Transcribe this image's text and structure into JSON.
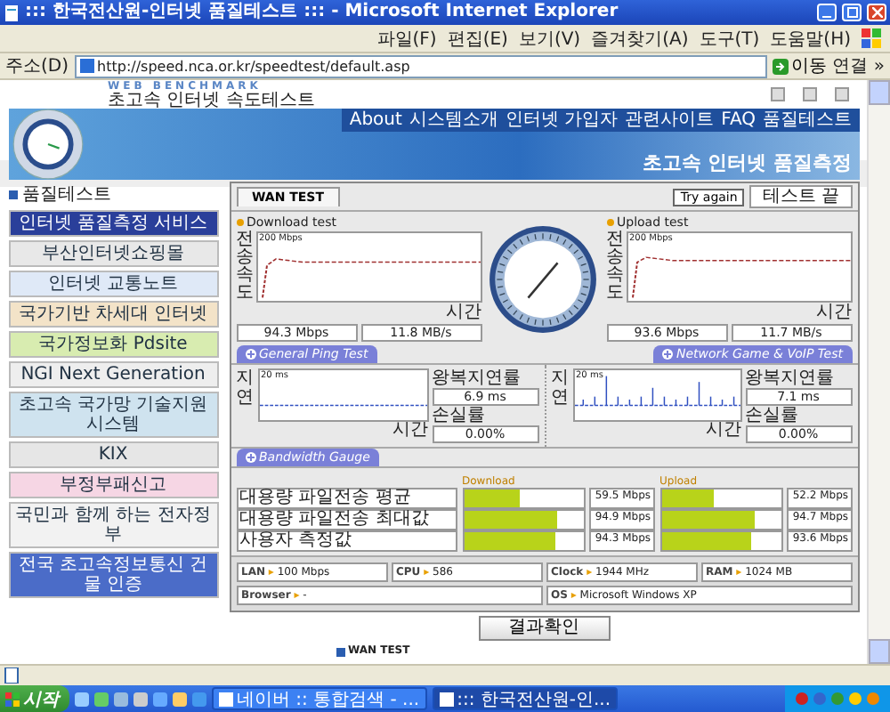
{
  "window": {
    "title": "::: 한국전산원-인터넷 품질테스트 ::: - Microsoft Internet Explorer"
  },
  "menu": [
    "파일(F)",
    "편집(E)",
    "보기(V)",
    "즐겨찾기(A)",
    "도구(T)",
    "도움말(H)"
  ],
  "address": {
    "label": "주소(D)",
    "value": "http://speed.nca.or.kr/speedtest/default.asp",
    "go": "이동",
    "links": "연결 »"
  },
  "header": {
    "tagline": "WEB BENCHMARK",
    "title": "초고속 인터넷 속도테스트"
  },
  "nav": [
    "About",
    "시스템소개",
    "인터넷 가입자",
    "관련사이트",
    "FAQ",
    "품질테스트"
  ],
  "banner": {
    "title": "초고속 인터넷 품질측정"
  },
  "sidebar": {
    "heading": "품질테스트",
    "banners": [
      "인터넷 품질측정 서비스",
      "부산인터넷쇼핑몰",
      "인터넷 교통노트",
      "국가기반 차세대 인터넷",
      "국가정보화 Pdsite",
      "NGI Next Generation",
      "초고속 국가망 기술지원 시스템",
      "KIX",
      "부정부패신고",
      "국민과 함께 하는 전자정부",
      "전국 초고속정보통신 건물 인증"
    ]
  },
  "test": {
    "tab": "WAN TEST",
    "try_again": "Try again",
    "status": "테스트 끝",
    "download": {
      "title": "Download test",
      "axis": "전송속도",
      "max": "200 Mbps",
      "time": "시간",
      "speed": "94.3 Mbps",
      "rate": "11.8 MB/s"
    },
    "upload": {
      "title": "Upload test",
      "axis": "전송속도",
      "max": "200 Mbps",
      "time": "시간",
      "speed": "93.6 Mbps",
      "rate": "11.7 MB/s"
    },
    "ping_tabs": [
      "General Ping Test",
      "Network Game & VoIP Test"
    ],
    "ping": [
      {
        "axis": "지연",
        "max": "20 ms",
        "delay_label": "왕복지연률",
        "delay": "6.9 ms",
        "loss_label": "손실률",
        "loss": "0.00%",
        "time": "시간"
      },
      {
        "axis": "지연",
        "max": "20 ms",
        "delay_label": "왕복지연률",
        "delay": "7.1 ms",
        "loss_label": "손실률",
        "loss": "0.00%",
        "time": "시간"
      }
    ],
    "gauge_tab": "Bandwidth Gauge",
    "gauge_columns": [
      "Download",
      "Upload"
    ],
    "gauge_rows": [
      {
        "label": "대용량 파일전송 평균",
        "download": {
          "level": 0.47,
          "value": "59.5 Mbps"
        },
        "upload": {
          "level": 0.44,
          "value": "52.2 Mbps"
        }
      },
      {
        "label": "대용량 파일전송 최대값",
        "download": {
          "level": 0.78,
          "value": "94.9 Mbps"
        },
        "upload": {
          "level": 0.78,
          "value": "94.7 Mbps"
        }
      },
      {
        "label": "사용자 측정값",
        "download": {
          "level": 0.77,
          "value": "94.3 Mbps"
        },
        "upload": {
          "level": 0.76,
          "value": "93.6 Mbps"
        }
      }
    ],
    "info": [
      {
        "label": "LAN",
        "marker": "▸",
        "value": "100 Mbps"
      },
      {
        "label": "CPU",
        "marker": "▸",
        "value": "586"
      },
      {
        "label": "Clock",
        "marker": "▸",
        "value": "1944 MHz"
      },
      {
        "label": "RAM",
        "marker": "▸",
        "value": "1024 MB"
      },
      {
        "label": "Browser",
        "marker": "▸",
        "value": "-"
      },
      {
        "label": "OS",
        "marker": "▸",
        "value": "Microsoft Windows XP"
      }
    ],
    "result_button": "결과확인",
    "footer_heading": "WAN TEST"
  },
  "taskbar": {
    "start": "시작",
    "tasks": [
      {
        "label": "네이버 :: 통합검색 - ...",
        "selected": false
      },
      {
        "label": "::: 한국전산원-인...",
        "selected": true
      }
    ]
  }
}
